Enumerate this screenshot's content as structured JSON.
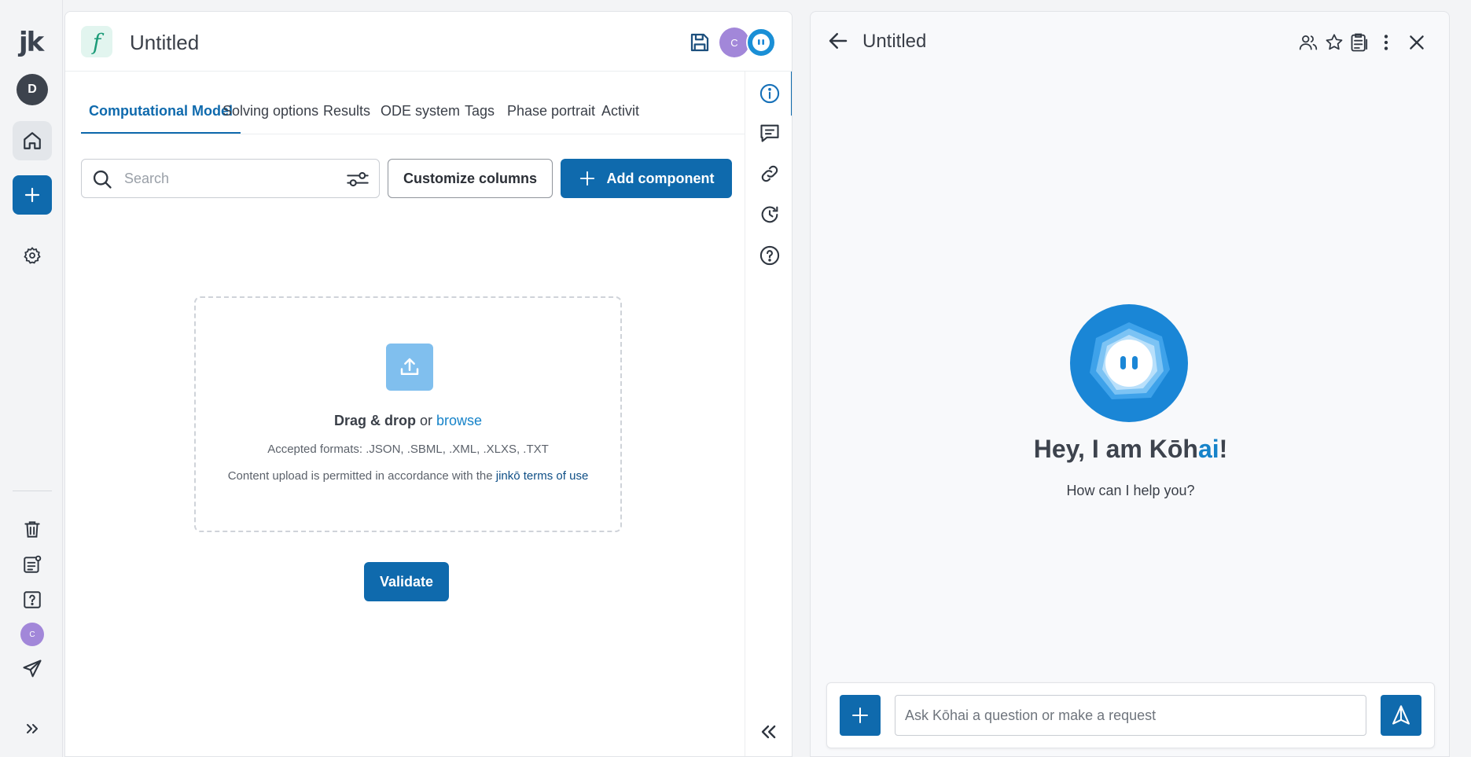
{
  "rail": {
    "logo": "jk",
    "user_initial": "D",
    "user_small_initial": "C",
    "icons": [
      "home-icon",
      "plus-icon",
      "gear-icon",
      "trash-icon",
      "notes-icon",
      "help-icon",
      "send-icon",
      "expand-icon"
    ]
  },
  "main": {
    "badge": "f",
    "title": "Untitled",
    "avatar_initial": "C",
    "tabs": [
      {
        "label": "Computational Model",
        "active": true
      },
      {
        "label": "Solving options"
      },
      {
        "label": "Results"
      },
      {
        "label": "ODE system"
      },
      {
        "label": "Tags"
      },
      {
        "label": "Phase portrait"
      },
      {
        "label": "Activit"
      }
    ],
    "search": {
      "placeholder": "Search",
      "value": ""
    },
    "customize_label": "Customize columns",
    "add_label": "Add component",
    "dropzone": {
      "drag": "Drag & drop",
      "or": " or ",
      "browse": "browse",
      "formats": "Accepted formats: .JSON, .SBML, .XML, .XLXS, .TXT",
      "terms_prefix": "Content upload is permitted in accordance with the ",
      "terms_link": "jinkō terms of use"
    },
    "validate_label": "Validate"
  },
  "assistant": {
    "title": "Untitled",
    "greeting_prefix": "Hey, I am Kōh",
    "greeting_ai": "ai",
    "greeting_suffix": "!",
    "subtitle": "How can I help you?",
    "input_placeholder": "Ask Kōhai a question or make a request"
  },
  "colors": {
    "primary": "#0f6aad",
    "link": "#1683c9",
    "avatar_purple": "#a287d9",
    "bot_blue": "#1a86d6"
  }
}
